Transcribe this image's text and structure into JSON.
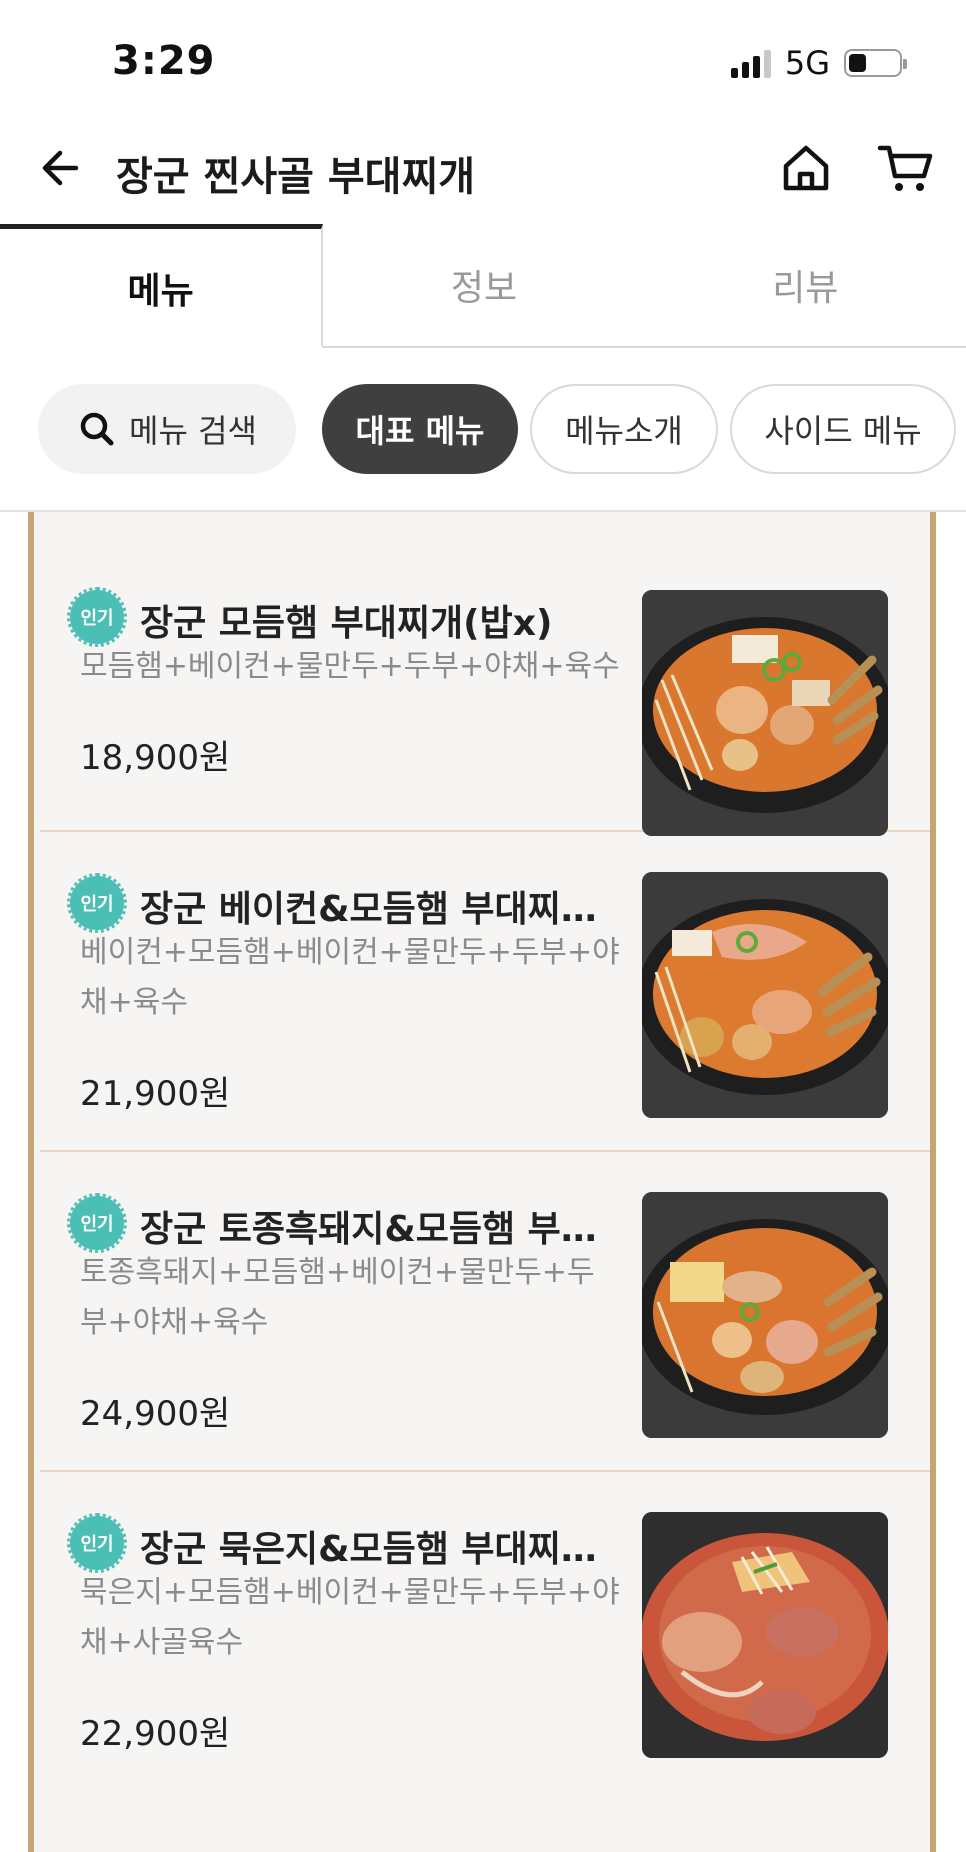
{
  "status": {
    "time": "3:29",
    "network": "5G",
    "battery_level": 0.35
  },
  "header": {
    "title": "장군 찐사골 부대찌개"
  },
  "tabs": [
    {
      "label": "메뉴",
      "active": true
    },
    {
      "label": "정보",
      "active": false
    },
    {
      "label": "리뷰",
      "active": false
    }
  ],
  "chips": {
    "search_label": "메뉴 검색",
    "items": [
      "대표 메뉴",
      "메뉴소개",
      "사이드 메뉴"
    ],
    "active_index": 0
  },
  "badge_label": "인기",
  "menu_items": [
    {
      "name": "장군 모듬햄 부대찌개(밥x)",
      "description": "모듬햄+베이컨+물만두+두부+야채+육수",
      "price": "18,900원",
      "photo_icon": "budae-jjigae-photo"
    },
    {
      "name": "장군 베이컨&모듬햄 부대찌…",
      "description": "베이컨+모듬햄+베이컨+물만두+두부+야채+육수",
      "price": "21,900원",
      "photo_icon": "budae-jjigae-photo"
    },
    {
      "name": "장군 토종흑돼지&모듬햄 부…",
      "description": "토종흑돼지+모듬햄+베이컨+물만두+두부+야채+육수",
      "price": "24,900원",
      "photo_icon": "budae-jjigae-photo"
    },
    {
      "name": "장군 묵은지&모듬햄 부대찌…",
      "description": "묵은지+모듬햄+베이컨+물만두+두부+야채+사골육수",
      "price": "22,900원",
      "photo_icon": "kimchi-jjigae-photo"
    }
  ],
  "colors": {
    "accent_border": "#c8a476",
    "badge": "#4bbfb5",
    "active_chip": "#3f3f3f"
  }
}
